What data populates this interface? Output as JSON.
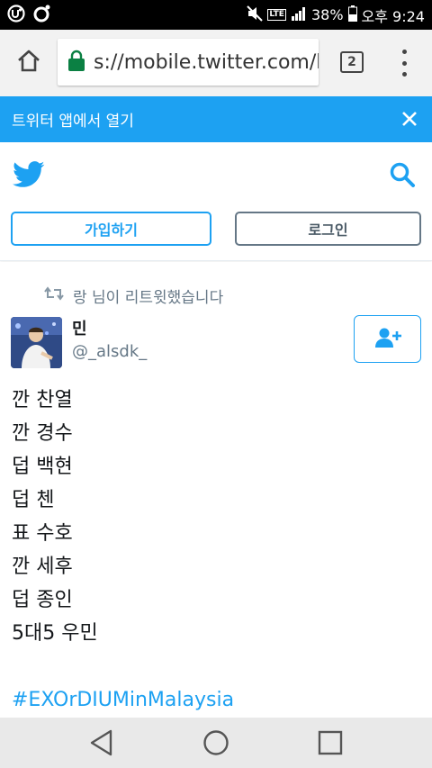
{
  "status_bar": {
    "network": "LTE",
    "battery": "38%",
    "time": "오후 9:24"
  },
  "browser": {
    "url": "s://mobile.twitter.com/k",
    "tab_count": "2"
  },
  "banner": {
    "text": "트위터 앱에서 열기"
  },
  "header": {
    "signup_label": "가입하기",
    "login_label": "로그인"
  },
  "tweet": {
    "retweet_context": "랑 님이 리트윗했습니다",
    "author_name": "민",
    "author_handle": "@_alsdk_",
    "lines": [
      "깐 찬열",
      "깐 경수",
      "덥 백현",
      "덥 첸",
      "표 수호",
      "깐 세후",
      "덥 종인",
      "5대5 우민"
    ],
    "hashtag": "#EXOrDIUMinMalaysia"
  },
  "colors": {
    "twitter_blue": "#1da1f2",
    "gray_text": "#657786",
    "status_bar_bg": "#000000",
    "nav_bar_bg": "#e9e9e9"
  },
  "icons": [
    "home-icon",
    "lock-icon",
    "tabs-icon",
    "overflow-menu-icon",
    "close-icon",
    "twitter-bird-icon",
    "search-icon",
    "retweet-icon",
    "follow-icon",
    "back-icon",
    "home-circle-icon",
    "recents-icon"
  ]
}
